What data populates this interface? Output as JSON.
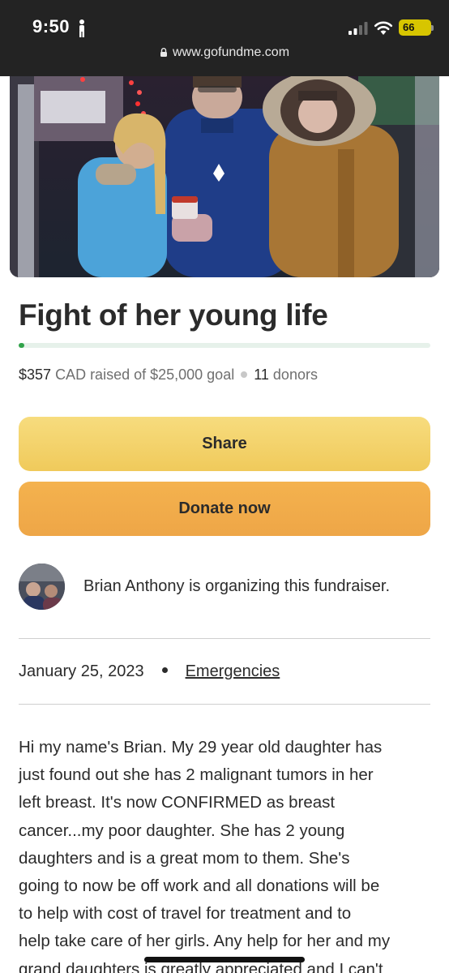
{
  "status_bar": {
    "time": "9:50",
    "battery_level": "66"
  },
  "browser": {
    "url": "www.gofundme.com"
  },
  "fundraiser": {
    "title": "Fight of her young life",
    "progress_fraction": 0.01428,
    "raised_amount": "$357",
    "raised_suffix": "CAD raised of $25,000 goal",
    "donor_count": "11",
    "donor_label": "donors",
    "share_label": "Share",
    "donate_label": "Donate now",
    "organizer_text": "Brian Anthony is organizing this fundraiser.",
    "date": "January 25, 2023",
    "category": "Emergencies",
    "story_lines": [
      "Hi my name's Brian. My 29 year old daughter has",
      "just found out she has 2 malignant tumors in her",
      "left breast. It's now CONFIRMED as breast",
      "cancer...my poor daughter. She has 2 young",
      "daughters and is a great mom to them. She's",
      "going to now be off work and all donations will be",
      "to help with cost of travel for treatment and to",
      "help take care of her girls. Any help for her and my",
      "grand daughters is greatly appreciated and I can't"
    ]
  },
  "colors": {
    "progress": "#31a34a",
    "share_button": "#f2cf63",
    "donate_button": "#efa94a"
  },
  "icons": [
    "person-icon",
    "signal-icon",
    "wifi-icon",
    "battery-icon",
    "lock-icon"
  ]
}
